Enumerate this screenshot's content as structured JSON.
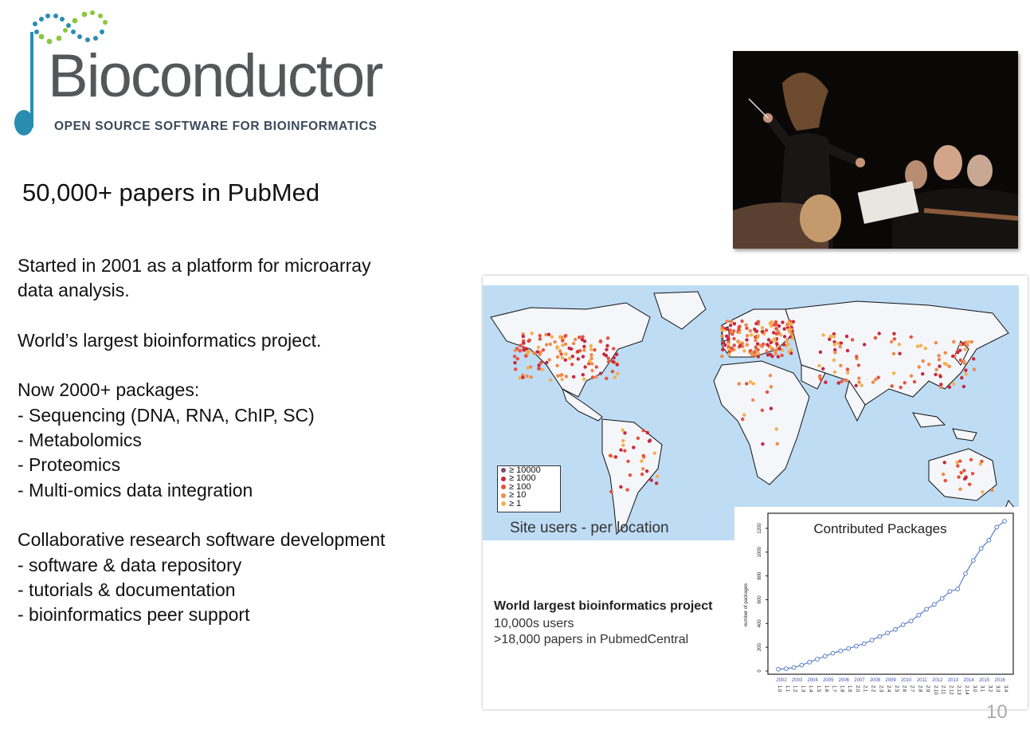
{
  "logo": {
    "wordmark": "Bioconductor",
    "tagline": "OPEN SOURCE SOFTWARE FOR BIOINFORMATICS",
    "color_text": "#555759",
    "color_note": "#2a8db0",
    "color_dots_green": "#8cc63f"
  },
  "headline": "50,000+ papers in PubMed",
  "body_lines": [
    "Started in 2001 as a platform for microarray",
    "data analysis.",
    "",
    "World’s largest bioinformatics project.",
    "",
    "Now 2000+ packages:",
    "- Sequencing (DNA, RNA, ChIP, SC)",
    "- Metabolomics",
    "- Proteomics",
    "- Multi-omics data integration",
    "",
    "Collaborative research software development",
    "- software & data repository",
    "- tutorials & documentation",
    "- bioinformatics peer support"
  ],
  "photo": {
    "icon": "orchestra-conductor-photo"
  },
  "map": {
    "caption": "Site users - per location",
    "ocean_color": "#bfdcf5",
    "land_color": "#f4f6fa",
    "legend": [
      {
        "label": "≥ 10000",
        "color": "#7d4a6a"
      },
      {
        "label": "≥ 1000",
        "color": "#c8283c"
      },
      {
        "label": "≥ 100",
        "color": "#e8503a"
      },
      {
        "label": "≥ 10",
        "color": "#f08a4b"
      },
      {
        "label": "≥ 1",
        "color": "#f5b04d"
      }
    ]
  },
  "world_largest": {
    "title": "World largest bioinformatics project",
    "line1": "10,000s users",
    "line2": ">18,000 papers in PubmedCentral"
  },
  "chart_data": {
    "type": "line",
    "title": "Contributed Packages",
    "ylabel": "number of packages",
    "xlabel": "",
    "ylim": [
      0,
      1300
    ],
    "yticks": [
      0,
      200,
      400,
      600,
      800,
      1000,
      1200
    ],
    "year_labels": [
      "2002",
      "2003",
      "2004",
      "2005",
      "2006",
      "2007",
      "2008",
      "2009",
      "2010",
      "2011",
      "2012",
      "2013",
      "2014",
      "2015",
      "2016"
    ],
    "version_labels": [
      "1.0",
      "1.1",
      "1.2",
      "1.3",
      "1.4",
      "1.5",
      "1.6",
      "1.7",
      "1.8",
      "1.9",
      "2.0",
      "2.1",
      "2.2",
      "2.3",
      "2.4",
      "2.5",
      "2.6",
      "2.7",
      "2.8",
      "2.9",
      "2.10",
      "2.11",
      "2.12",
      "2.13",
      "2.14",
      "3.0",
      "3.1",
      "3.2",
      "3.3",
      "3.4"
    ],
    "series": [
      {
        "values": [
          15,
          20,
          30,
          50,
          75,
          100,
          125,
          150,
          170,
          190,
          210,
          230,
          260,
          290,
          320,
          350,
          390,
          420,
          470,
          520,
          560,
          610,
          670,
          690,
          820,
          930,
          1030,
          1100,
          1210,
          1260
        ]
      }
    ],
    "color": "#5b7fc7",
    "grid": false
  },
  "page_number": "10"
}
